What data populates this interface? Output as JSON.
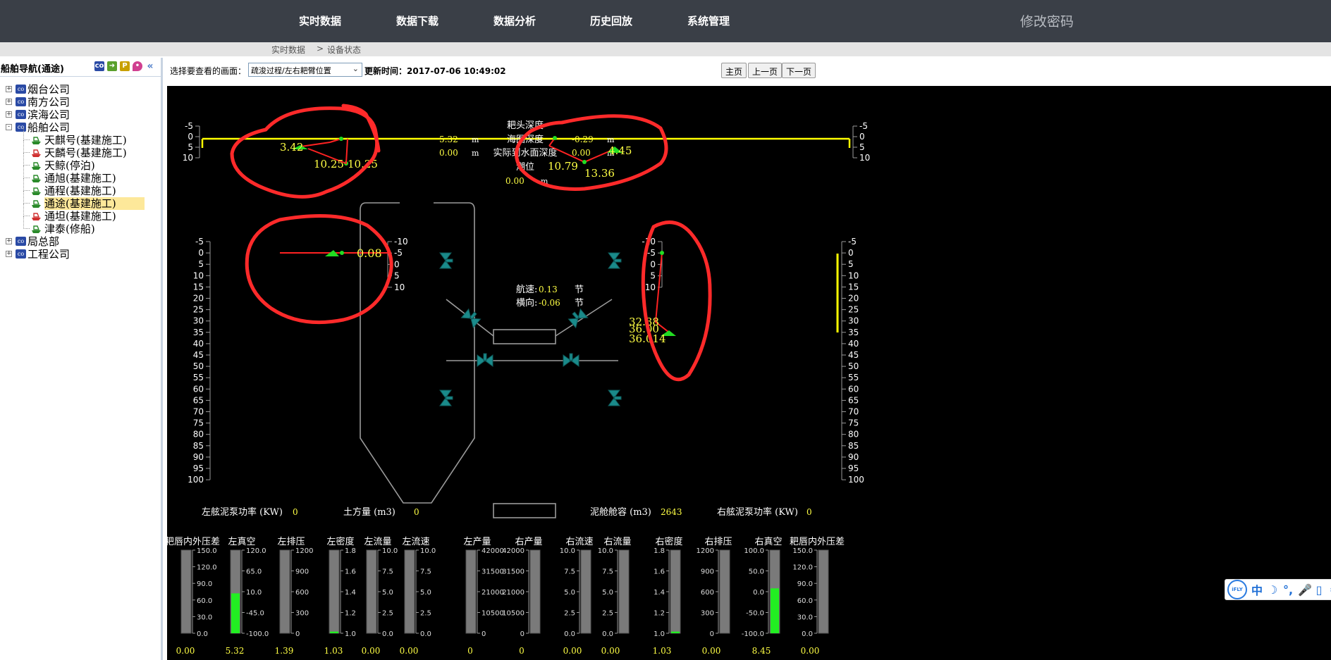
{
  "nav": {
    "items": [
      "实时数据",
      "数据下载",
      "数据分析",
      "历史回放",
      "系统管理"
    ],
    "password": "修改密码"
  },
  "breadcrumb": {
    "root": "实时数据",
    "sep": ">",
    "current": "设备状态"
  },
  "sidebar": {
    "title": "船舶导航(通途)",
    "tree": [
      {
        "label": "烟台公司",
        "kind": "company",
        "level": 0,
        "expander": "+"
      },
      {
        "label": "南方公司",
        "kind": "company",
        "level": 0,
        "expander": "+"
      },
      {
        "label": "滨海公司",
        "kind": "company",
        "level": 0,
        "expander": "+"
      },
      {
        "label": "船舶公司",
        "kind": "company",
        "level": 0,
        "expander": "-"
      },
      {
        "label": "天麒号(基建施工)",
        "kind": "ship-green",
        "level": 1
      },
      {
        "label": "天麟号(基建施工)",
        "kind": "ship-red",
        "level": 1
      },
      {
        "label": "天鲸(停泊)",
        "kind": "ship-green",
        "level": 1
      },
      {
        "label": "通旭(基建施工)",
        "kind": "ship-green",
        "level": 1
      },
      {
        "label": "通程(基建施工)",
        "kind": "ship-green",
        "level": 1
      },
      {
        "label": "通途(基建施工)",
        "kind": "ship-green",
        "level": 1,
        "selected": true
      },
      {
        "label": "通坦(基建施工)",
        "kind": "ship-red",
        "level": 1
      },
      {
        "label": "津泰(修船)",
        "kind": "ship-green",
        "level": 1
      },
      {
        "label": "局总部",
        "kind": "company",
        "level": 0,
        "expander": "+"
      },
      {
        "label": "工程公司",
        "kind": "company",
        "level": 0,
        "expander": "+"
      }
    ]
  },
  "toolbar": {
    "select_label": "选择要查看的画面：",
    "selected_view": "疏浚过程/左右耙臂位置",
    "update_label": "更新时间：2017-07-06 10:49:02",
    "home": "主页",
    "prev": "上一页",
    "next": "下一页"
  },
  "top_info": {
    "drag_depth_label": "耙头深度",
    "chart_depth_label": "海图深度",
    "actual_depth_label": "实际到水面深度",
    "tide_label": "潮位",
    "left_drag_depth": "5.32",
    "left_actual_depth": "0.00",
    "right_chart_depth": "-0.29",
    "right_actual_depth": "0.00",
    "tide": "0.00",
    "unit_m": "m"
  },
  "speed": {
    "speed_label": "航速:",
    "speed": "0.13",
    "lateral_label": "横向:",
    "lateral": "-0.06",
    "unit": "节"
  },
  "arm_values": {
    "left_upper": [
      "3.42",
      "10.25",
      "10.25"
    ],
    "right_upper": [
      "10.79",
      "13.36",
      "4.45"
    ],
    "left_lower": [
      "0.08"
    ],
    "right_lower": [
      "32.38",
      "36.00",
      "36.014"
    ]
  },
  "scales": {
    "top": [
      "-5",
      "0",
      "5",
      "10"
    ],
    "mid_small": [
      "-10",
      "-5",
      "0",
      "5",
      "10"
    ],
    "depth": [
      "-5",
      "0",
      "5",
      "10",
      "15",
      "20",
      "25",
      "30",
      "35",
      "40",
      "45",
      "50",
      "55",
      "60",
      "65",
      "70",
      "75",
      "80",
      "85",
      "90",
      "95",
      "100"
    ]
  },
  "bottom": {
    "left_pump_label": "左舷泥泵功率 (KW)",
    "left_pump": "0",
    "earth_label": "土方量 (m3)",
    "earth": "0",
    "hold_label": "泥舱舱容 (m3)",
    "hold": "2643",
    "right_pump_label": "右舷泥泵功率 (KW)",
    "right_pump": "0"
  },
  "gauges": [
    {
      "label": "耙唇内外压差",
      "ticks": [
        "150.0",
        "120.0",
        "90.0",
        "60.0",
        "30.0",
        "0.0"
      ],
      "value": "0.00",
      "fill": 0.0
    },
    {
      "label": "左真空",
      "ticks": [
        "120.0",
        "65.0",
        "10.0",
        "-45.0",
        "-100.0"
      ],
      "value": "5.32",
      "fill": 0.48
    },
    {
      "label": "左排压",
      "ticks": [
        "1200",
        "900",
        "600",
        "300",
        "0"
      ],
      "value": "1.39",
      "fill": 0.0
    },
    {
      "label": "左密度",
      "ticks": [
        "1.8",
        "1.6",
        "1.4",
        "1.2",
        "1.0"
      ],
      "value": "1.03",
      "fill": 0.02
    },
    {
      "label": "左流量",
      "ticks": [
        "10.0",
        "7.5",
        "5.0",
        "2.5",
        "0.0"
      ],
      "value": "0.00",
      "fill": 0.0
    },
    {
      "label": "左流速",
      "ticks": [
        "10.0",
        "7.5",
        "5.0",
        "2.5",
        "0.0"
      ],
      "value": "0.00",
      "fill": 0.0
    },
    {
      "label": "左产量",
      "ticks": [
        "42000",
        "31500",
        "21000",
        "10500",
        "0"
      ],
      "value": "0",
      "fill": 0.0
    },
    {
      "label": "右产量",
      "ticks": [
        "42000",
        "31500",
        "21000",
        "10500",
        "0"
      ],
      "value": "0",
      "fill": 0.0
    },
    {
      "label": "右流速",
      "ticks": [
        "10.0",
        "7.5",
        "5.0",
        "2.5",
        "0.0"
      ],
      "value": "0.00",
      "fill": 0.0
    },
    {
      "label": "右流量",
      "ticks": [
        "10.0",
        "7.5",
        "5.0",
        "2.5",
        "0.0"
      ],
      "value": "0.00",
      "fill": 0.0
    },
    {
      "label": "右密度",
      "ticks": [
        "1.8",
        "1.6",
        "1.4",
        "1.2",
        "1.0"
      ],
      "value": "1.03",
      "fill": 0.02
    },
    {
      "label": "右排压",
      "ticks": [
        "1200",
        "900",
        "600",
        "300",
        "0"
      ],
      "value": "0.00",
      "fill": 0.0
    },
    {
      "label": "右真空",
      "ticks": [
        "100.0",
        "50.0",
        "0.0",
        "-50.0",
        "-100.0"
      ],
      "value": "8.45",
      "fill": 0.54
    },
    {
      "label": "耙唇内外压差",
      "ticks": [
        "150.0",
        "120.0",
        "90.0",
        "60.0",
        "30.0",
        "0.0"
      ],
      "value": "0.00",
      "fill": 0.0
    }
  ],
  "ifly": {
    "logo": "iFLY",
    "icons": [
      "中",
      "☽",
      "°,",
      "🎤",
      "▯",
      "⚙"
    ]
  },
  "colors": {
    "label": "#ffffff",
    "value": "#ffff44",
    "arm": "#ff2222",
    "drag": "#22dd22",
    "valve": "#1a8a8a",
    "annotation": "#ff2a2a",
    "hull": "#9a9a9a"
  }
}
